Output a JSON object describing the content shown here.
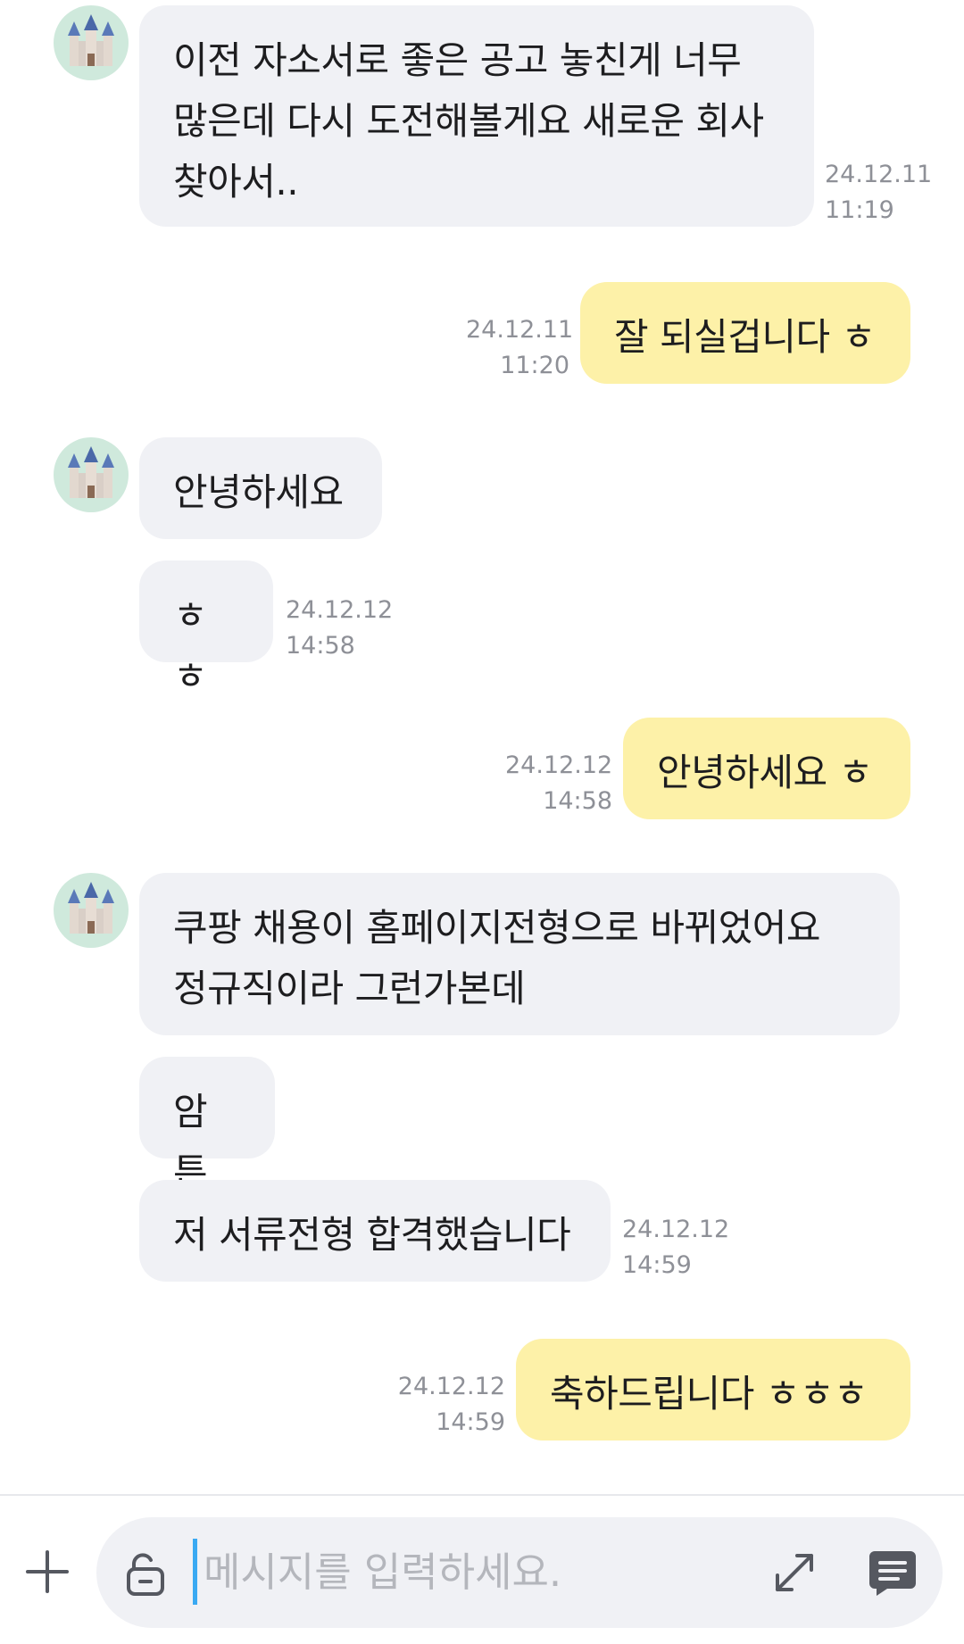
{
  "messages": [
    {
      "side": "in",
      "text": "이전 자소서로 좋은 공고 놓친게 너무\n많은데 다시 도전해볼게요 새로운 회사\n찾아서..",
      "date": "24.12.11",
      "time": "11:19"
    },
    {
      "side": "out",
      "text": "잘 되실겁니다 ㅎ",
      "date": "24.12.11",
      "time": "11:20"
    },
    {
      "side": "in",
      "text": "안녕하세요"
    },
    {
      "side": "in",
      "text": "ㅎㅎ",
      "date": "24.12.12",
      "time": "14:58"
    },
    {
      "side": "out",
      "text": "안녕하세요 ㅎ",
      "date": "24.12.12",
      "time": "14:58"
    },
    {
      "side": "in",
      "text": "쿠팡 채용이 홈페이지전형으로 바뀌었어요\n정규직이라 그런가본데"
    },
    {
      "side": "in",
      "text": "암튼"
    },
    {
      "side": "in",
      "text": "저 서류전형 합격했습니다",
      "date": "24.12.12",
      "time": "14:59"
    },
    {
      "side": "out",
      "text": "축하드립니다 ㅎㅎㅎ",
      "date": "24.12.12",
      "time": "14:59"
    }
  ],
  "composer": {
    "placeholder": "메시지를 입력하세요.",
    "icons": [
      "plus-icon",
      "lock-icon",
      "expand-icon",
      "emoticon-icon"
    ]
  },
  "colors": {
    "incoming_bubble": "#f0f1f5",
    "outgoing_bubble": "#fdf1a8",
    "timestamp": "#8e9097",
    "caret": "#3aa9f2",
    "avatar_bg": "#cfe9dc"
  },
  "avatar": {
    "icon": "castle-icon"
  }
}
